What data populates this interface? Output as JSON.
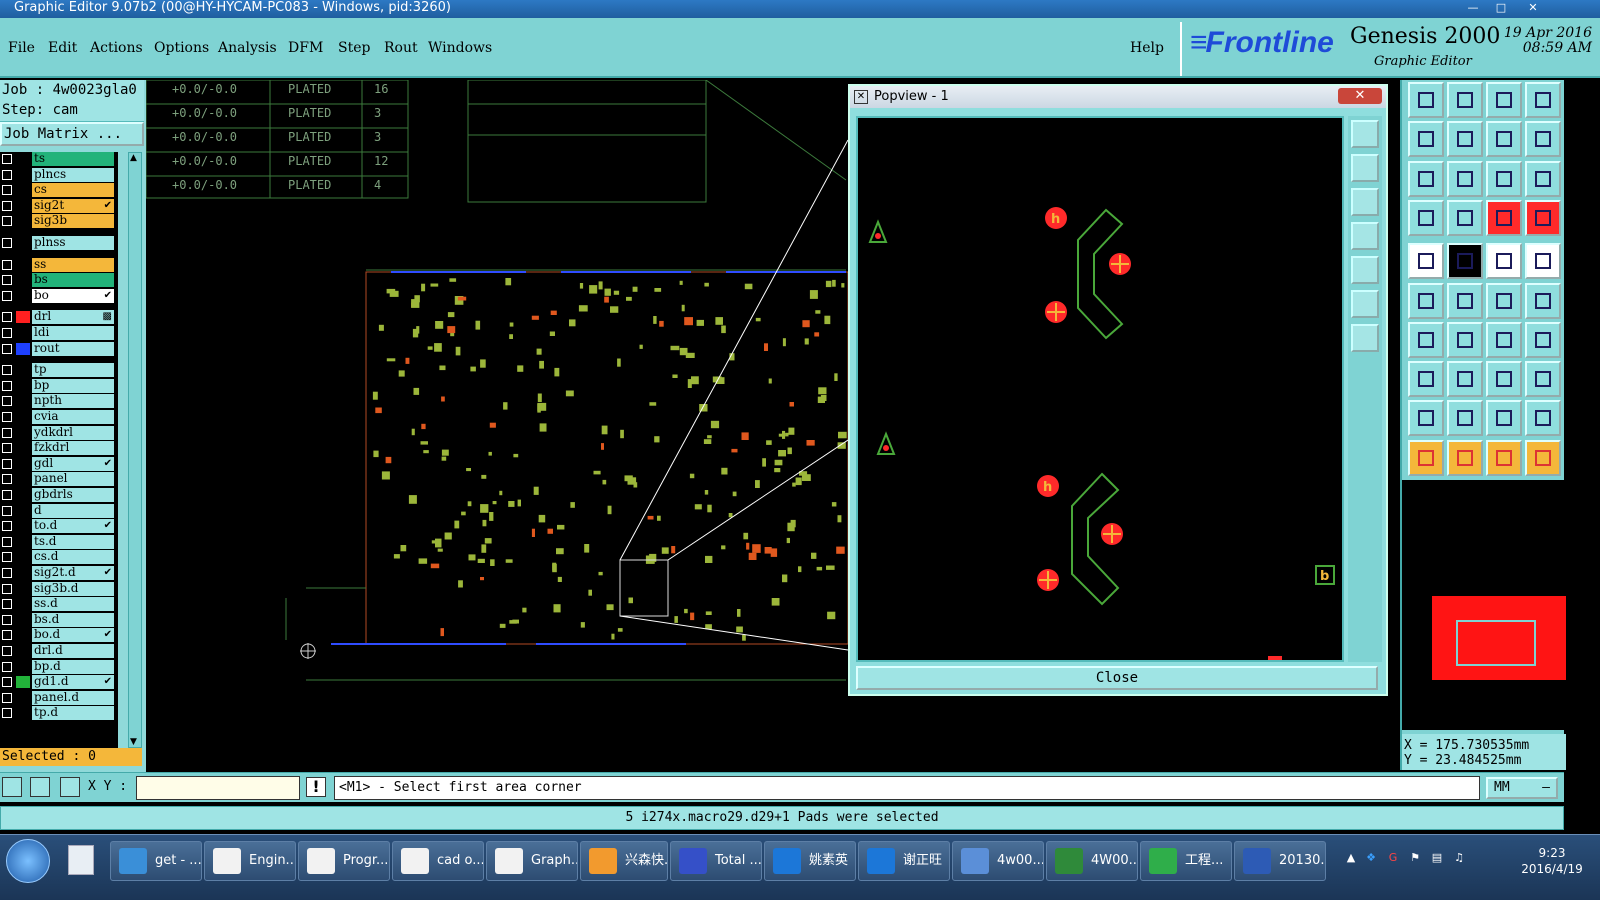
{
  "window": {
    "title": "Graphic Editor 9.07b2 (00@HY-HYCAM-PC083 - Windows, pid:3260)"
  },
  "menu": {
    "items": [
      "File",
      "Edit",
      "Actions",
      "Options",
      "Analysis",
      "DFM",
      "Step",
      "Rout",
      "Windows"
    ],
    "help": "Help"
  },
  "brand": {
    "logo": "Frontline",
    "product": "Genesis 2000",
    "subtitle": "Graphic Editor",
    "date": "19 Apr 2016",
    "time": "08:59 AM"
  },
  "job": {
    "job_label": "Job : 4w0023gla0",
    "step_label": "Step: cam",
    "matrix_button": "Job Matrix ..."
  },
  "layers": [
    {
      "name": "ts",
      "color": "#22b37a"
    },
    {
      "name": "plncs",
      "color": "#9fe4e4"
    },
    {
      "name": "cs",
      "color": "#f4b73a"
    },
    {
      "name": "sig2t",
      "color": "#f4b73a",
      "mark": "✔"
    },
    {
      "name": "sig3b",
      "color": "#f4b73a"
    },
    {
      "name": "plnss",
      "color": "#9fe4e4"
    },
    {
      "name": "ss",
      "color": "#f4b73a"
    },
    {
      "name": "bs",
      "color": "#22b37a"
    },
    {
      "name": "bo",
      "color": "#ffffff",
      "mark": "✔"
    },
    {
      "name": "drl",
      "color": "#9fe4e4",
      "swatch": "#ff2020",
      "mark": "▩"
    },
    {
      "name": "ldi",
      "color": "#9fe4e4"
    },
    {
      "name": "rout",
      "color": "#9fe4e4",
      "swatch": "#1e40ff"
    },
    {
      "name": "tp",
      "color": "#9fe4e4"
    },
    {
      "name": "bp",
      "color": "#9fe4e4"
    },
    {
      "name": "npth",
      "color": "#9fe4e4"
    },
    {
      "name": "cvia",
      "color": "#9fe4e4"
    },
    {
      "name": "ydkdrl",
      "color": "#9fe4e4"
    },
    {
      "name": "fzkdrl",
      "color": "#9fe4e4"
    },
    {
      "name": "gdl",
      "color": "#9fe4e4",
      "mark": "✔"
    },
    {
      "name": "panel",
      "color": "#9fe4e4"
    },
    {
      "name": "gbdrls",
      "color": "#9fe4e4"
    },
    {
      "name": "d",
      "color": "#9fe4e4"
    },
    {
      "name": "to.d",
      "color": "#9fe4e4",
      "mark": "✔"
    },
    {
      "name": "ts.d",
      "color": "#9fe4e4"
    },
    {
      "name": "cs.d",
      "color": "#9fe4e4"
    },
    {
      "name": "sig2t.d",
      "color": "#9fe4e4",
      "mark": "✔"
    },
    {
      "name": "sig3b.d",
      "color": "#9fe4e4"
    },
    {
      "name": "ss.d",
      "color": "#9fe4e4"
    },
    {
      "name": "bs.d",
      "color": "#9fe4e4"
    },
    {
      "name": "bo.d",
      "color": "#9fe4e4",
      "mark": "✔"
    },
    {
      "name": "drl.d",
      "color": "#9fe4e4"
    },
    {
      "name": "bp.d",
      "color": "#9fe4e4"
    },
    {
      "name": "gd1.d",
      "color": "#9fe4e4",
      "swatch": "#22b33a",
      "mark": "✔"
    },
    {
      "name": "panel.d",
      "color": "#9fe4e4"
    },
    {
      "name": "tp.d",
      "color": "#9fe4e4"
    }
  ],
  "selected_label": "Selected : 0",
  "drill_table": [
    {
      "tol": "+0.0/-0.0",
      "type": "PLATED",
      "qty": "16"
    },
    {
      "tol": "+0.0/-0.0",
      "type": "PLATED",
      "qty": "3"
    },
    {
      "tol": "+0.0/-0.0",
      "type": "PLATED",
      "qty": "3"
    },
    {
      "tol": "+0.0/-0.0",
      "type": "PLATED",
      "qty": "12"
    },
    {
      "tol": "+0.0/-0.0",
      "type": "PLATED",
      "qty": "4"
    }
  ],
  "popview": {
    "title": "Popview - 1",
    "close_x": "✕",
    "close_button": "Close"
  },
  "coords": {
    "x": "X = 175.730535mm",
    "y": "Y = 23.484525mm"
  },
  "cmd": {
    "xy_label": "X Y :",
    "prompt": "<M1> - Select first area corner",
    "units": "MM"
  },
  "status": "5 i274x.macro29.d29+1 Pads were selected",
  "taskbar": {
    "tasks": [
      {
        "label": "get - ...",
        "icon": "#3a8fd8"
      },
      {
        "label": "Engin...",
        "icon": "#f2f2f2"
      },
      {
        "label": "Progr...",
        "icon": "#f2f2f2"
      },
      {
        "label": "cad o...",
        "icon": "#f2f2f2"
      },
      {
        "label": "Graph...",
        "icon": "#f2f2f2"
      },
      {
        "label": "兴森快...",
        "icon": "#f29a2e"
      },
      {
        "label": "Total ...",
        "icon": "#3550c8"
      },
      {
        "label": "姚素英",
        "icon": "#1c77d8"
      },
      {
        "label": "谢正旺",
        "icon": "#1c77d8"
      },
      {
        "label": "4w00...",
        "icon": "#5b8fd8"
      },
      {
        "label": "4W00...",
        "icon": "#2f8a3a"
      },
      {
        "label": "工程...",
        "icon": "#2fae4a"
      },
      {
        "label": "20130...",
        "icon": "#2d5bb5"
      }
    ],
    "time": "9:23",
    "date": "2016/4/19"
  }
}
